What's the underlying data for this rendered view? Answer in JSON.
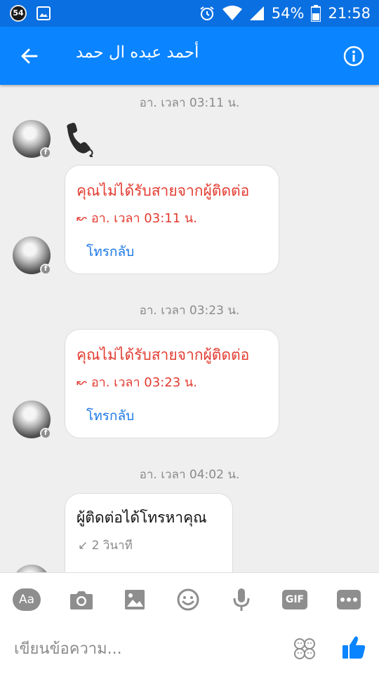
{
  "status_bar": {
    "notif_badge": "54",
    "battery": "54%",
    "time": "21:58"
  },
  "header": {
    "title": "أحمد عبده ال حمد",
    "back_icon": "arrow-left-icon",
    "info_icon": "info-icon"
  },
  "messages": [
    {
      "timestamp": "อา. เวลา 03:11 น."
    },
    {
      "missed_title": "คุณไม่ได้รับสายจากผู้ติดต่อ",
      "missed_time": "อา. เวลา 03:11 น.",
      "callback": "โทรกลับ"
    },
    {
      "timestamp": "อา. เวลา 03:23 น."
    },
    {
      "missed_title": "คุณไม่ได้รับสายจากผู้ติดต่อ",
      "missed_time": "อา. เวลา 03:23 น.",
      "callback": "โทรกลับ"
    },
    {
      "timestamp": "อา. เวลา 04:02 น."
    },
    {
      "incoming_title": "ผู้ติดต่อได้โทรหาคุณ",
      "duration": "2 วินาที"
    }
  ],
  "composer": {
    "aa_label": "Aa",
    "gif_label": "GIF",
    "placeholder": "เขียนข้อความ..."
  },
  "colors": {
    "header": "#0a84ff",
    "status_bar": "#0a6fe0",
    "missed": "#e23b30",
    "link": "#1c78e6",
    "like": "#0a84ff"
  }
}
